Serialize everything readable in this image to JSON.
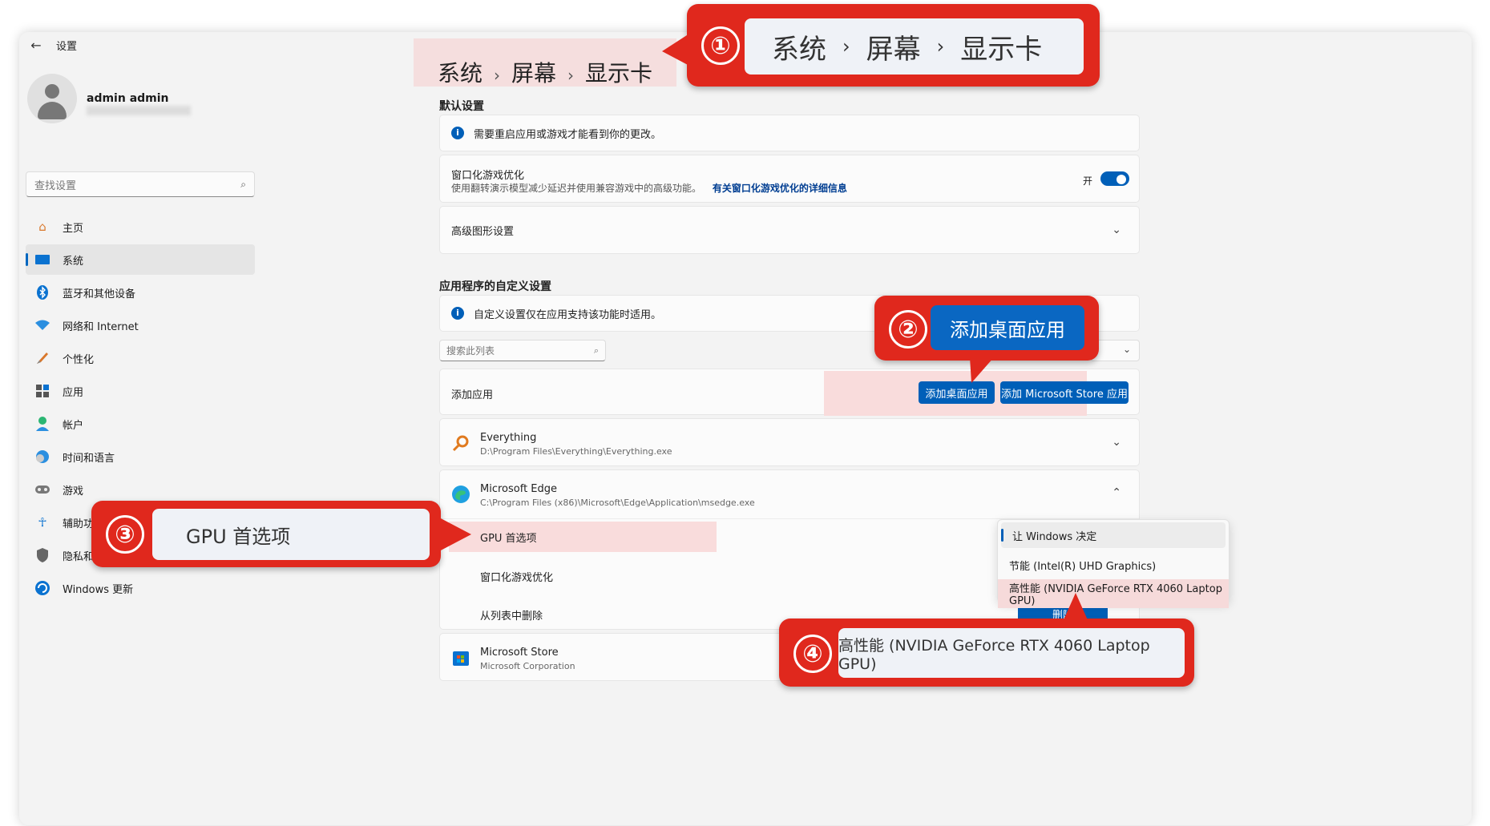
{
  "window": {
    "title": "设置",
    "back_icon": "back-arrow-icon"
  },
  "profile": {
    "name": "admin admin"
  },
  "search": {
    "placeholder": "查找设置",
    "icon": "search-icon"
  },
  "nav": [
    {
      "label": "主页",
      "icon": "home-icon"
    },
    {
      "label": "系统",
      "icon": "display-icon",
      "active": true
    },
    {
      "label": "蓝牙和其他设备",
      "icon": "bluetooth-icon"
    },
    {
      "label": "网络和 Internet",
      "icon": "wifi-icon"
    },
    {
      "label": "个性化",
      "icon": "brush-icon"
    },
    {
      "label": "应用",
      "icon": "apps-icon"
    },
    {
      "label": "帐户",
      "icon": "account-icon"
    },
    {
      "label": "时间和语言",
      "icon": "globe-clock-icon"
    },
    {
      "label": "游戏",
      "icon": "gamepad-icon"
    },
    {
      "label": "辅助功能",
      "icon": "accessibility-icon"
    },
    {
      "label": "隐私和安全性",
      "icon": "shield-icon"
    },
    {
      "label": "Windows 更新",
      "icon": "update-icon"
    }
  ],
  "breadcrumb": {
    "part1": "系统",
    "part2": "屏幕",
    "part3": "显示卡",
    "separator": "›"
  },
  "default_settings": {
    "header": "默认设置",
    "restart_notice": "需要重启应用或游戏才能看到你的更改。",
    "windowed_opt": {
      "title": "窗口化游戏优化",
      "desc": "使用翻转演示模型减少延迟并使用兼容游戏中的高级功能。",
      "link": "有关窗口化游戏优化的详细信息",
      "state_label": "开",
      "on": true
    },
    "advanced": "高级图形设置"
  },
  "custom_settings": {
    "header": "应用程序的自定义设置",
    "notice": "自定义设置仅在应用支持该功能时适用。",
    "search_placeholder": "搜索此列表",
    "add_app_label": "添加应用",
    "add_desktop_btn": "添加桌面应用",
    "add_store_btn": "添加 Microsoft Store 应用"
  },
  "apps": [
    {
      "name": "Everything",
      "path": "D:\\Program Files\\Everything\\Everything.exe",
      "icon": "everything-magnifier-icon"
    },
    {
      "name": "Microsoft Edge",
      "path": "C:\\Program Files (x86)\\Microsoft\\Edge\\Application\\msedge.exe",
      "icon": "edge-icon"
    },
    {
      "name": "Microsoft Store",
      "path": "Microsoft Corporation",
      "icon": "store-icon"
    }
  ],
  "edge_options": {
    "gpu_pref": "GPU 首选项",
    "windowed": "窗口化游戏优化",
    "remove": "从列表中删除",
    "remove_btn": "删除"
  },
  "gpu_dropdown": {
    "options": [
      "让 Windows 决定",
      "节能 (Intel(R) UHD Graphics)",
      "高性能 (NVIDIA GeForce RTX 4060 Laptop GPU)"
    ],
    "selected_index": 0,
    "highlighted_index": 2
  },
  "annotations": {
    "a1": {
      "num": "①",
      "text1": "系统",
      "text2": "屏幕",
      "text3": "显示卡",
      "sep": "›"
    },
    "a2": {
      "num": "②",
      "text": "添加桌面应用"
    },
    "a3": {
      "num": "③",
      "text": "GPU 首选项"
    },
    "a4": {
      "num": "④",
      "text": "高性能 (NVIDIA GeForce RTX 4060 Laptop GPU)"
    }
  },
  "colors": {
    "accent": "#005fb8",
    "annotation_red": "#e0281d",
    "highlight_pink": "#f9dcdc"
  }
}
